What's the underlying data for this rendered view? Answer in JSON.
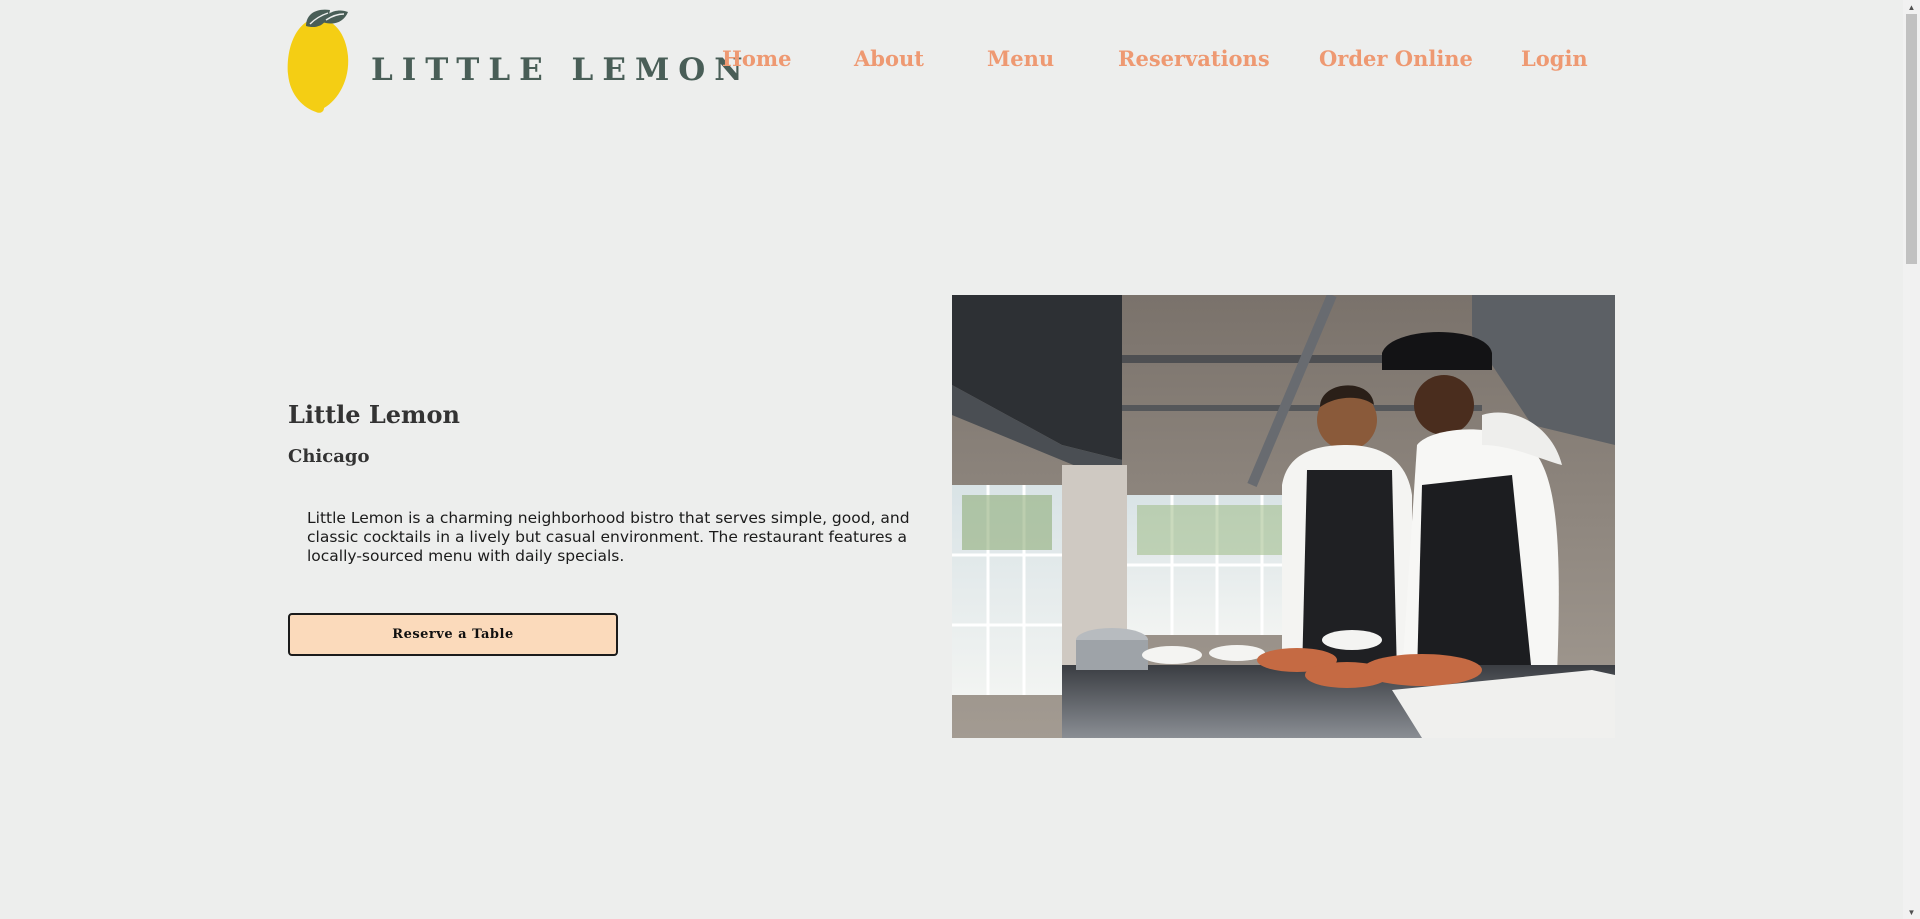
{
  "brand": {
    "name": "LITTLE LEMON",
    "logo_icon": "lemon-icon",
    "colors": {
      "lemon": "#f4ce14",
      "leaf": "#495e57",
      "accent": "#ee9972",
      "button": "#fbdabb"
    }
  },
  "nav": {
    "items": [
      {
        "label": "Home"
      },
      {
        "label": "About"
      },
      {
        "label": "Menu"
      },
      {
        "label": "Reservations"
      },
      {
        "label": "Order Online"
      },
      {
        "label": "Login"
      }
    ]
  },
  "hero": {
    "title": "Little Lemon",
    "subtitle": "Chicago",
    "description": "Little Lemon is a charming neighborhood bistro that serves simple, good, and classic cocktails in a lively but casual environment. The restaurant features a locally-sourced menu with daily specials.",
    "button_label": "Reserve a Table",
    "image_icon": "chefs-kitchen-photo"
  },
  "scrollbar": {
    "up_icon": "arrow-up-icon",
    "down_icon": "arrow-down-icon"
  }
}
